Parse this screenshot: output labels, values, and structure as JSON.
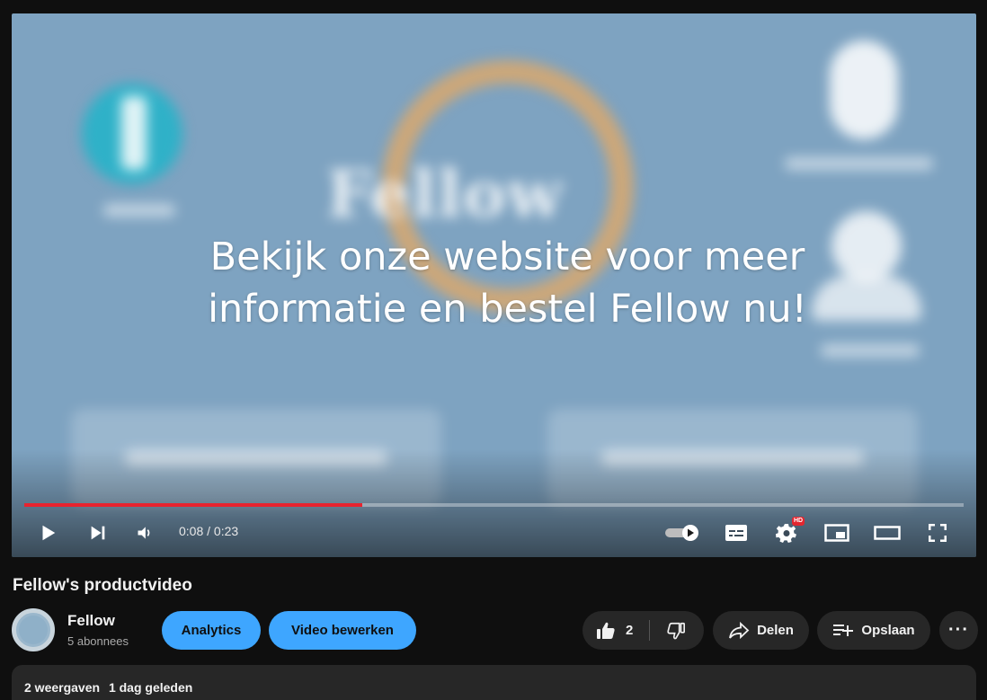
{
  "player": {
    "overlay_line1": "Bekijk onze website voor meer",
    "overlay_line2": "informatie en bestel Fellow nu!",
    "background_brand_text": "Fellow",
    "time_display": "0:08 / 0:23",
    "progress_fraction": 0.36,
    "colors": {
      "video_bg": "#7ea3c1",
      "progress": "#e8232e",
      "ring": "#d9a86d",
      "teal": "#2fb1c8"
    },
    "icons": [
      "play-icon",
      "next-icon",
      "volume-icon",
      "autoplay-toggle-icon",
      "subtitles-icon",
      "settings-icon",
      "miniplayer-icon",
      "theater-icon",
      "fullscreen-icon"
    ],
    "hd_badge": "HD"
  },
  "video": {
    "title": "Fellow's productvideo"
  },
  "channel": {
    "name": "Fellow",
    "subscribers": "5 abonnees"
  },
  "actions": {
    "analytics": "Analytics",
    "edit_video": "Video bewerken",
    "like_count": "2",
    "share": "Delen",
    "save": "Opslaan",
    "more": "···"
  },
  "description": {
    "views": "2 weergaven",
    "date": "1 dag geleden"
  },
  "colors": {
    "page_bg": "#0f0f0f",
    "accent_blue": "#3ea6ff",
    "chip_bg": "#272727"
  }
}
